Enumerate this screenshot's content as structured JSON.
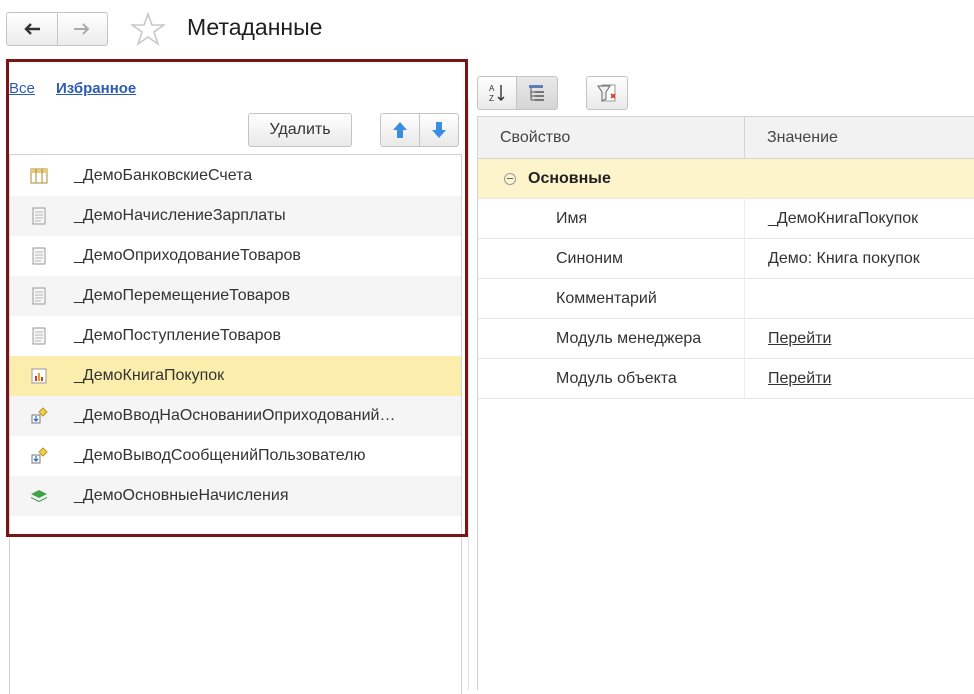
{
  "window": {
    "title": "Метаданные",
    "back_icon": "arrow-left-icon",
    "forward_icon": "arrow-right-icon",
    "favorite_icon": "star-icon"
  },
  "left_pane": {
    "filter_links": {
      "all": "Все",
      "favorites": "Избранное"
    },
    "delete_label": "Удалить",
    "items": [
      {
        "label": "_ДемоБанковскиеСчета",
        "icon": "catalog-icon"
      },
      {
        "label": "_ДемоНачислениеЗарплаты",
        "icon": "document-icon"
      },
      {
        "label": "_ДемоОприходованиеТоваров",
        "icon": "document-icon"
      },
      {
        "label": "_ДемоПеремещениеТоваров",
        "icon": "document-icon"
      },
      {
        "label": "_ДемоПоступлениеТоваров",
        "icon": "document-icon"
      },
      {
        "label": "_ДемоКнигаПокупок",
        "icon": "report-icon",
        "selected": true
      },
      {
        "label": "_ДемоВводНаОснованииОприходований…",
        "icon": "processing-icon"
      },
      {
        "label": "_ДемоВыводСообщенийПользователю",
        "icon": "processing-icon"
      },
      {
        "label": "_ДемоОсновныеНачисления",
        "icon": "calculation-type-icon"
      }
    ]
  },
  "right_pane": {
    "columns": {
      "property": "Свойство",
      "value": "Значение"
    },
    "group": "Основные",
    "rows": [
      {
        "property": "Имя",
        "value": "_ДемоКнигаПокупок"
      },
      {
        "property": "Синоним",
        "value": "Демо: Книга покупок"
      },
      {
        "property": "Комментарий",
        "value": ""
      },
      {
        "property": "Модуль менеджера",
        "value": "Перейти",
        "link": true
      },
      {
        "property": "Модуль объекта",
        "value": "Перейти",
        "link": true
      }
    ]
  },
  "colors": {
    "selection": "#fbeeac",
    "group_row": "#fdf4cc",
    "highlight_frame": "#7b1515",
    "link": "#2c5bb0"
  }
}
